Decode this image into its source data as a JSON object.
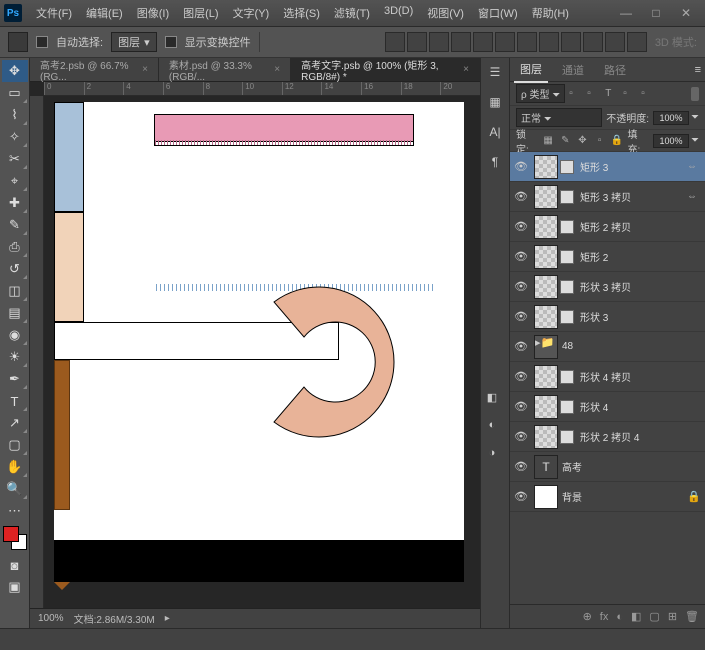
{
  "menu": [
    "文件(F)",
    "编辑(E)",
    "图像(I)",
    "图层(L)",
    "文字(Y)",
    "选择(S)",
    "滤镜(T)",
    "3D(D)",
    "视图(V)",
    "窗口(W)",
    "帮助(H)"
  ],
  "win": {
    "min": "—",
    "max": "□",
    "close": "✕"
  },
  "options": {
    "auto": "自动选择:",
    "mode": "图层",
    "show": "显示变换控件",
    "mode3d": "3D 模式:"
  },
  "tabs": [
    {
      "label": "高考2.psb @ 66.7%(RG...",
      "active": false
    },
    {
      "label": "素材.psd @ 33.3%(RGB/...",
      "active": false
    },
    {
      "label": "高考文字.psb @ 100% (矩形 3, RGB/8#) *",
      "active": true
    }
  ],
  "ruler": [
    "0",
    "2",
    "4",
    "6",
    "8",
    "10",
    "12",
    "14",
    "16",
    "18",
    "20"
  ],
  "status": {
    "zoom": "100%",
    "doc": "文档:2.86M/3.30M"
  },
  "panel": {
    "tabs": [
      "图层",
      "通道",
      "路径"
    ],
    "kind": "ρ 类型",
    "blend": "正常",
    "opacity_lbl": "不透明度:",
    "opacity": "100%",
    "lock_lbl": "锁定:",
    "fill_lbl": "填充:",
    "fill": "100%"
  },
  "layers": [
    {
      "name": "矩形 3",
      "sel": true,
      "link": true
    },
    {
      "name": "矩形 3 拷贝",
      "link": true
    },
    {
      "name": "矩形 2 拷贝"
    },
    {
      "name": "矩形 2"
    },
    {
      "name": "形状 3 拷贝"
    },
    {
      "name": "形状 3"
    },
    {
      "name": "48",
      "folder": true
    },
    {
      "name": "形状 4 拷贝"
    },
    {
      "name": "形状 4"
    },
    {
      "name": "形状 2 拷贝 4"
    },
    {
      "name": "高考",
      "text": true
    },
    {
      "name": "背景",
      "bg": true,
      "lock": true
    }
  ],
  "foot_icons": [
    "⊕",
    "fx",
    "◐",
    "◧",
    "▢",
    "⊞",
    "🗑"
  ]
}
